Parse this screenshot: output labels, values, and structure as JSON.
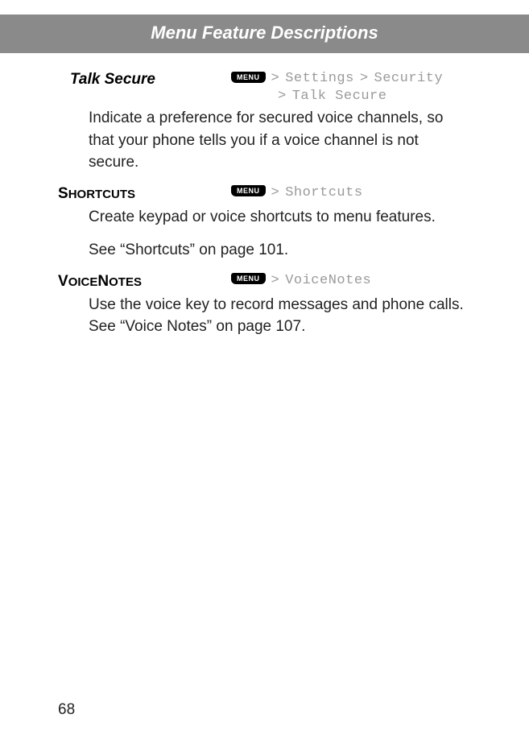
{
  "header": {
    "title": "Menu Feature Descriptions"
  },
  "menuKey": "MENU",
  "separator": ">",
  "sections": {
    "talkSecure": {
      "title": "Talk Secure",
      "path1a": "Settings",
      "path1b": "Security",
      "path2": "Talk Secure",
      "body": "Indicate a preference for secured voice channels, so that your phone tells you if a voice channel is not secure."
    },
    "shortcuts": {
      "titleFirst": "S",
      "titleRest": "HORTCUTS",
      "path": "Shortcuts",
      "body1": "Create keypad or voice shortcuts to menu features.",
      "body2": "See “Shortcuts” on page 101."
    },
    "voicenotes": {
      "titleFirst": "V",
      "titleRest1": "OICE",
      "titleFirst2": "N",
      "titleRest2": "OTES",
      "path": "VoiceNotes",
      "body": "Use the voice key to record messages and phone calls. See “Voice Notes” on page 107."
    }
  },
  "pageNumber": "68"
}
